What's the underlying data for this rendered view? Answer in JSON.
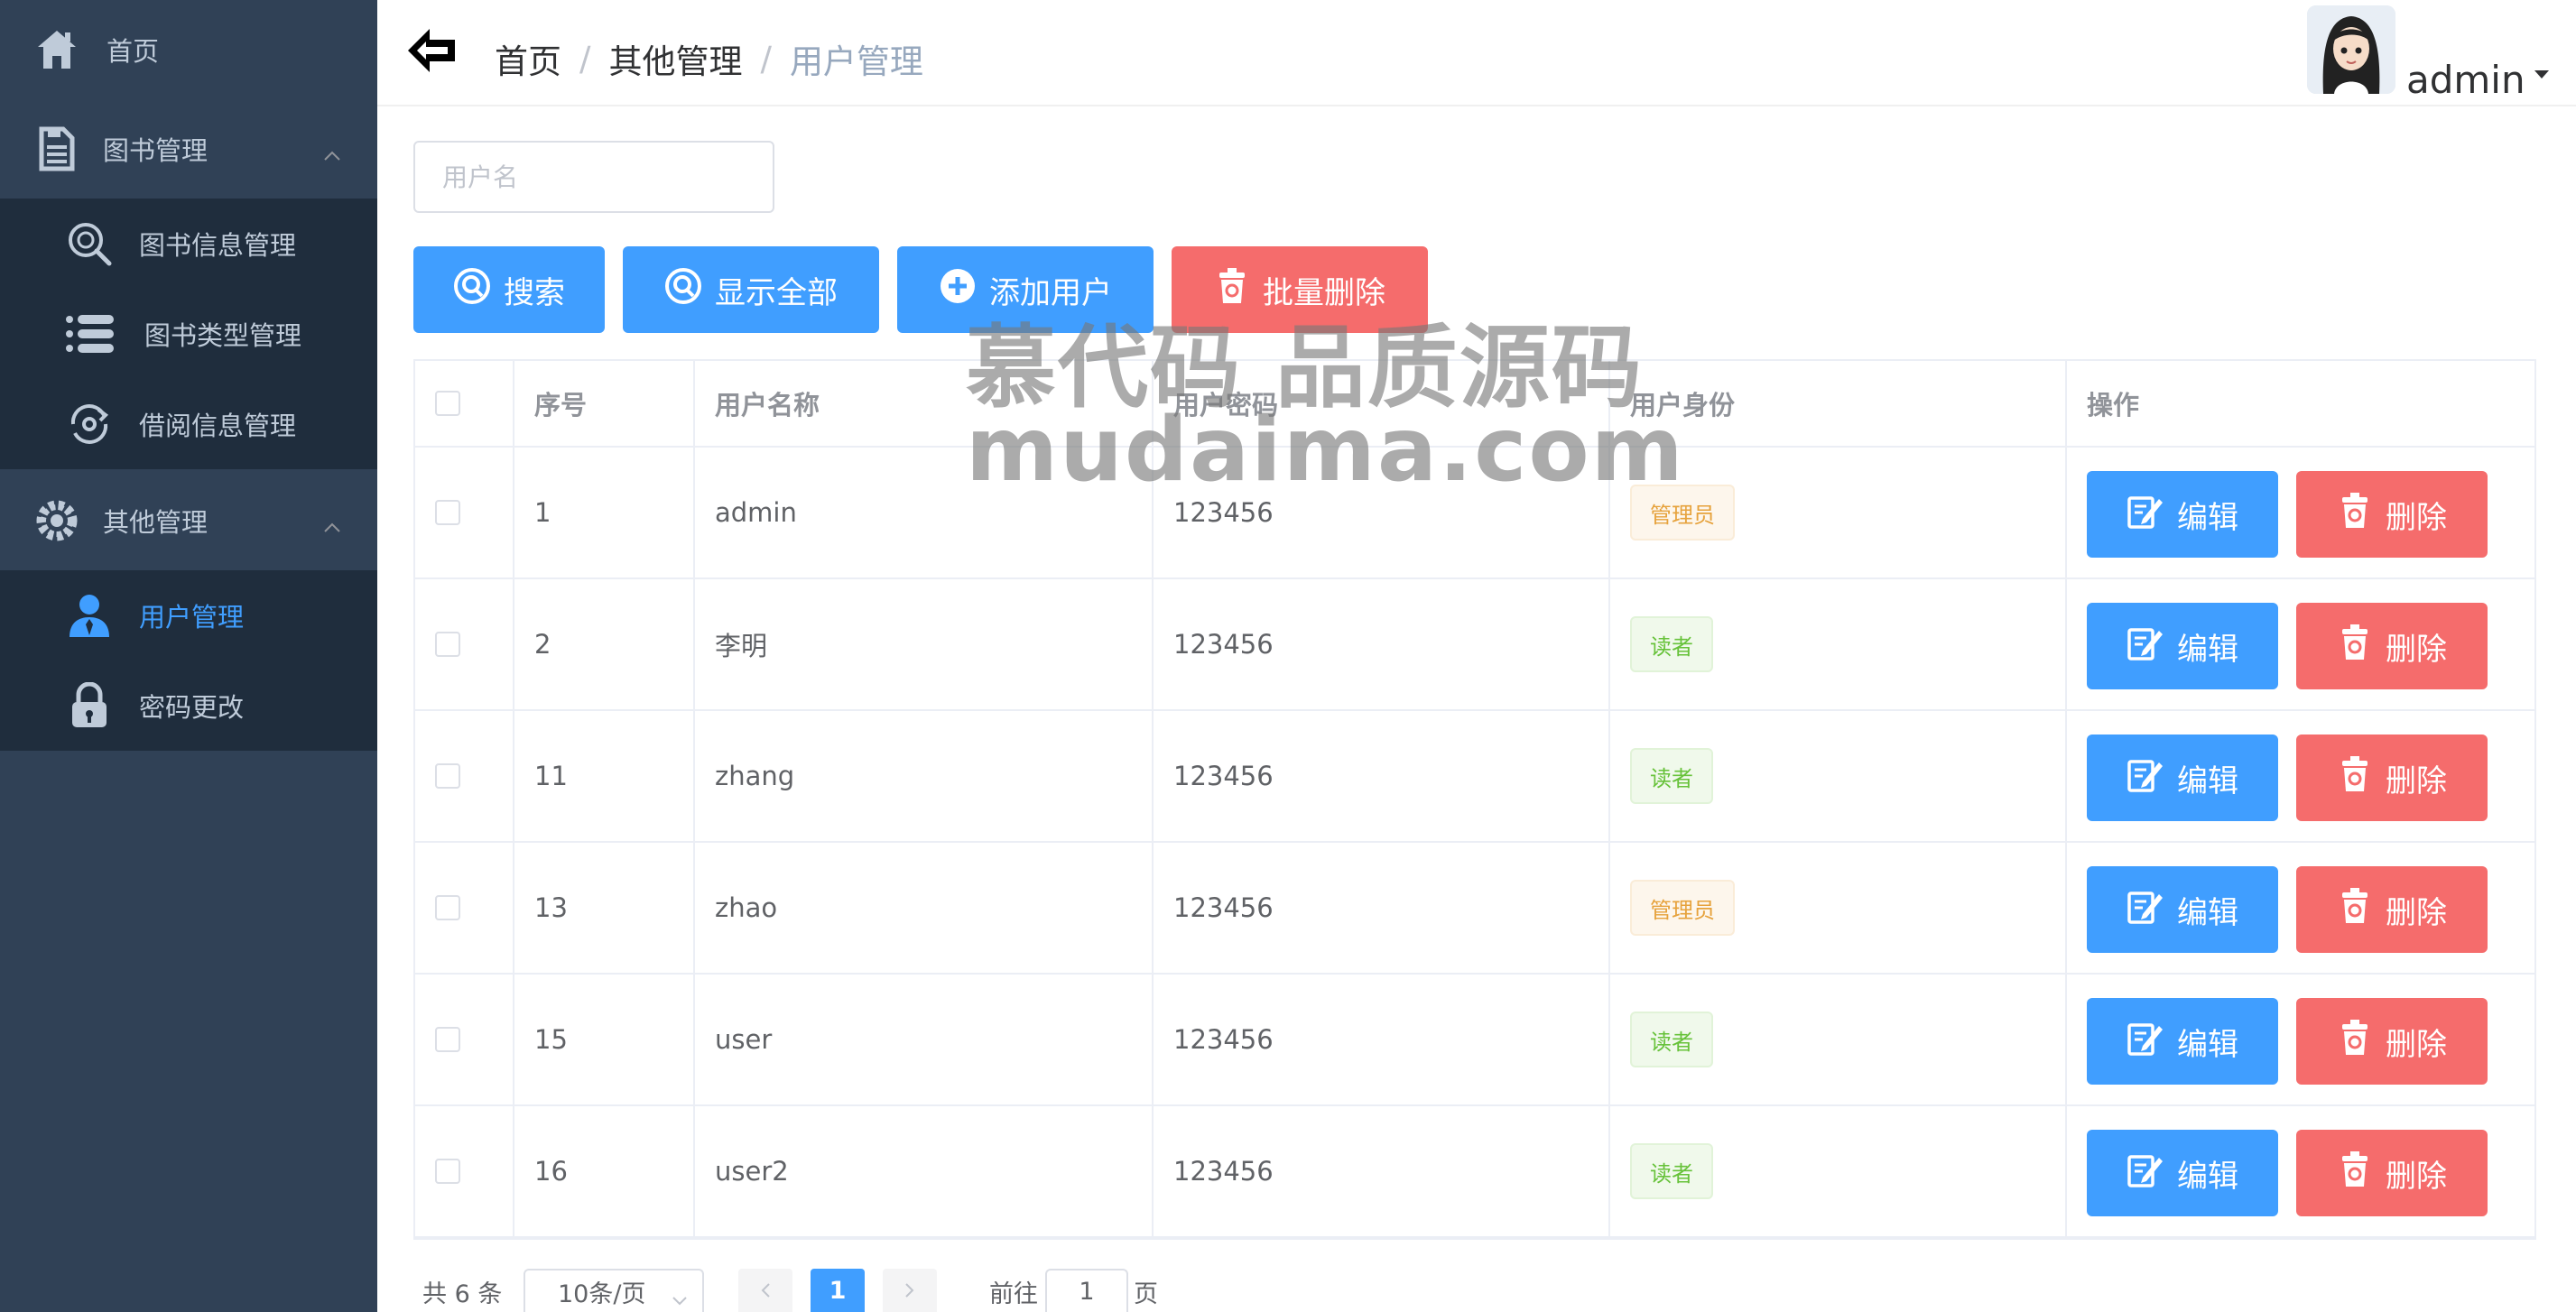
{
  "sidebar": {
    "home": "首页",
    "book_mgmt": "图书管理",
    "book_info": "图书信息管理",
    "book_type": "图书类型管理",
    "borrow_info": "借阅信息管理",
    "other_mgmt": "其他管理",
    "user_mgmt": "用户管理",
    "pwd_change": "密码更改"
  },
  "header": {
    "breadcrumb": [
      "首页",
      "其他管理",
      "用户管理"
    ],
    "separator": "/",
    "user": "admin"
  },
  "search": {
    "placeholder": "用户名"
  },
  "toolbar": {
    "search": "搜索",
    "show_all": "显示全部",
    "add_user": "添加用户",
    "batch_delete": "批量删除"
  },
  "table": {
    "columns": [
      "序号",
      "用户名称",
      "用户密码",
      "用户身份",
      "操作"
    ],
    "rows": [
      {
        "id": "1",
        "name": "admin",
        "password": "123456",
        "role": "管理员",
        "role_type": "admin"
      },
      {
        "id": "2",
        "name": "李明",
        "password": "123456",
        "role": "读者",
        "role_type": "reader"
      },
      {
        "id": "11",
        "name": "zhang",
        "password": "123456",
        "role": "读者",
        "role_type": "reader"
      },
      {
        "id": "13",
        "name": "zhao",
        "password": "123456",
        "role": "管理员",
        "role_type": "admin"
      },
      {
        "id": "15",
        "name": "user",
        "password": "123456",
        "role": "读者",
        "role_type": "reader"
      },
      {
        "id": "16",
        "name": "user2",
        "password": "123456",
        "role": "读者",
        "role_type": "reader"
      }
    ],
    "edit": "编辑",
    "delete": "删除"
  },
  "pagination": {
    "total": "共 6 条",
    "page_size": "10条/页",
    "current": "1",
    "goto_prefix": "前往",
    "goto_value": "1",
    "goto_suffix": "页"
  },
  "watermark": {
    "line1": "慕代码 品质源码",
    "line2": "mudaima.com"
  },
  "colors": {
    "sidebar": "#304156",
    "submenu": "#1f2d3d",
    "primary": "#409eff",
    "danger": "#f56c6c"
  }
}
